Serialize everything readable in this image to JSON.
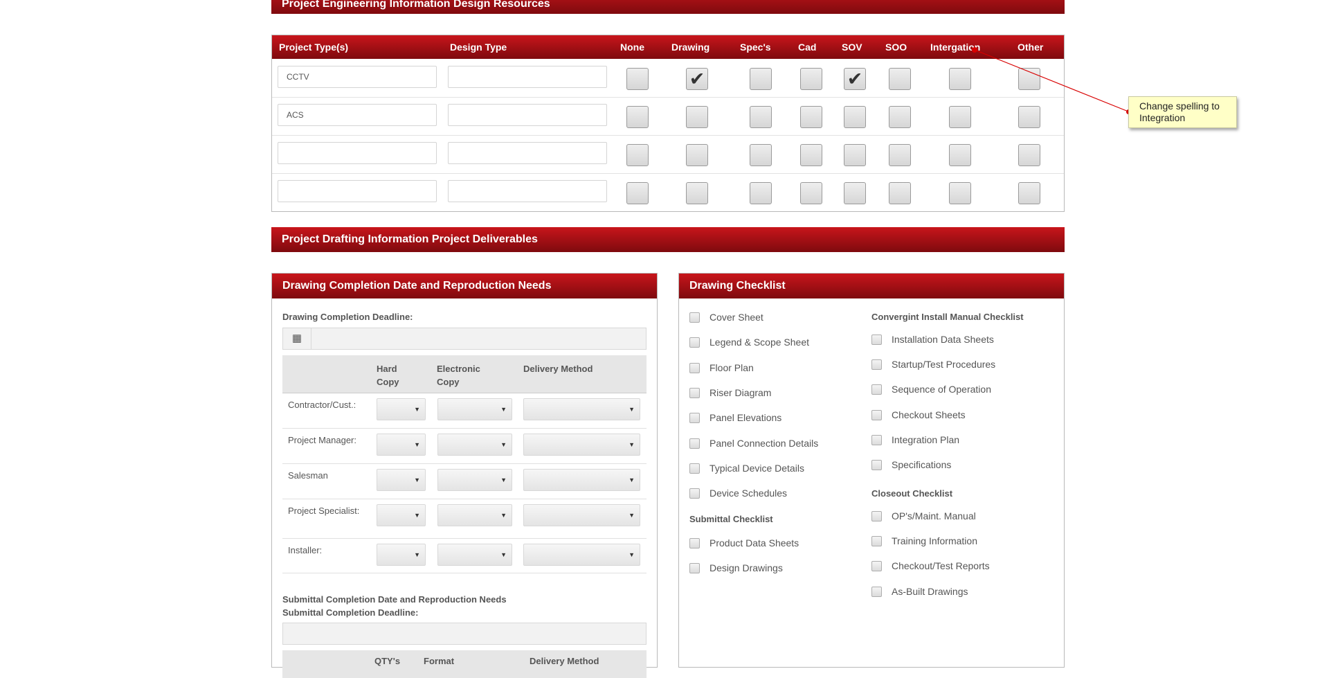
{
  "sections": {
    "engineering_title": "Project Engineering Information Design Resources",
    "drafting_title": "Project Drafting Information Project Deliverables"
  },
  "engineering_table": {
    "headers": [
      "Project Type(s)",
      "Design Type",
      "None",
      "Drawing",
      "Spec's",
      "Cad",
      "SOV",
      "SOO",
      "Intergation",
      "Other"
    ],
    "rows": [
      {
        "project_type": "CCTV",
        "design_type": "",
        "checks": [
          false,
          true,
          false,
          false,
          true,
          false,
          false,
          false
        ]
      },
      {
        "project_type": "ACS",
        "design_type": "",
        "checks": [
          false,
          false,
          false,
          false,
          false,
          false,
          false,
          false
        ]
      },
      {
        "project_type": "",
        "design_type": "",
        "checks": [
          false,
          false,
          false,
          false,
          false,
          false,
          false,
          false
        ]
      },
      {
        "project_type": "",
        "design_type": "",
        "checks": [
          false,
          false,
          false,
          false,
          false,
          false,
          false,
          false
        ]
      }
    ],
    "check_glyph": "✔"
  },
  "completion_panel": {
    "title": "Drawing Completion Date and Reproduction Needs",
    "deadline_label": "Drawing Completion Deadline:",
    "calendar_icon": "▦",
    "columns": [
      "Hard Copy",
      "Electronic Copy",
      "Delivery Method"
    ],
    "rows": [
      "Contractor/Cust.:",
      "Project Manager:",
      "Salesman",
      "Project Specialist:",
      "Installer:"
    ],
    "dropdown_arrow": "▼",
    "submittal_title": "Submittal Completion Date and Reproduction Needs",
    "submittal_deadline_label": "Submittal Completion Deadline:",
    "submittal_columns": [
      "QTY's",
      "Format",
      "Delivery Method"
    ]
  },
  "checklist_panel": {
    "title": "Drawing Checklist",
    "left_items": [
      "Cover Sheet",
      "Legend & Scope Sheet",
      "Floor Plan",
      "Riser Diagram",
      "Panel Elevations",
      "Panel Connection Details",
      "Typical Device Details",
      "Device Schedules"
    ],
    "submittal_heading": "Submittal Checklist",
    "submittal_items": [
      "Product Data Sheets",
      "Design Drawings"
    ],
    "install_heading": "Convergint Install Manual Checklist",
    "install_items": [
      "Installation Data Sheets",
      "Startup/Test Procedures",
      "Sequence of Operation",
      "Checkout Sheets",
      "Integration Plan",
      "Specifications"
    ],
    "closeout_heading": "Closeout Checklist",
    "closeout_items": [
      "OP's/Maint. Manual",
      "Training Information",
      "Checkout/Test Reports",
      "As-Built Drawings"
    ]
  },
  "annotation": {
    "text": "Change spelling to Integration",
    "color": "#d80000"
  }
}
